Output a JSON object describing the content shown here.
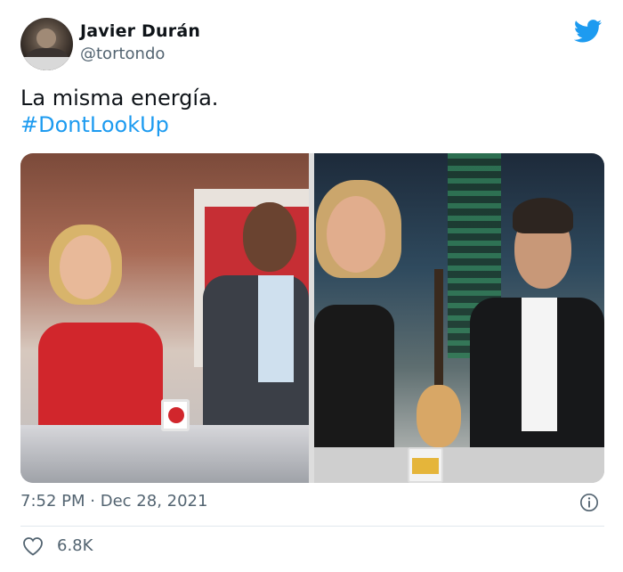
{
  "author": {
    "name": "Javier Durán",
    "handle": "@tortondo",
    "avatar_icon": "chimpanzee-avatar"
  },
  "platform_icon": "twitter-bird-icon",
  "tweet": {
    "text": "La misma energía.",
    "hashtag": "#DontLookUp"
  },
  "media": {
    "photos": [
      {
        "name": "tv-studio-photo-left"
      },
      {
        "name": "tv-studio-photo-right"
      }
    ]
  },
  "meta": {
    "time": "7:52 PM",
    "separator": "·",
    "date": "Dec 28, 2021",
    "info_icon": "info-icon"
  },
  "actions": {
    "like_icon": "heart-icon",
    "like_count": "6.8K"
  },
  "colors": {
    "accent": "#1d9bf0",
    "text": "#0f1419",
    "muted": "#536471"
  }
}
